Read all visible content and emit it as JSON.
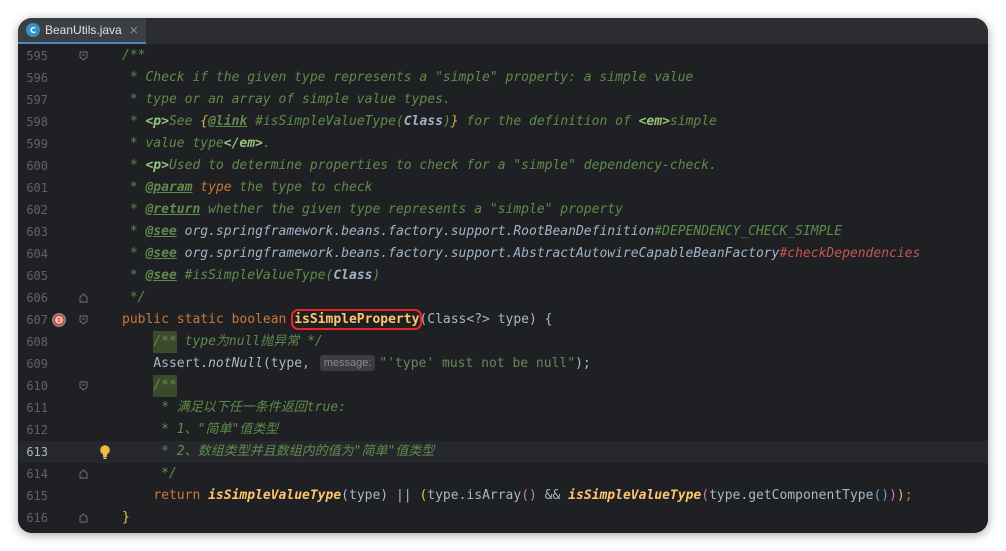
{
  "tab": {
    "icon_letter": "C",
    "file_name": "BeanUtils.java",
    "close_glyph": "×"
  },
  "editor": {
    "current_line": "613"
  },
  "lines": [
    {
      "n": "595",
      "t": [
        "/**"
      ]
    },
    {
      "n": "596",
      "t": [
        " * Check if the given type represents a \"simple\" property: a simple value"
      ]
    },
    {
      "n": "597",
      "t": [
        " * type or an array of simple value types."
      ]
    },
    {
      "n": "598",
      "t": [
        " * ",
        "<p>",
        "See ",
        "{",
        "@link",
        " #isSimpleValueType(",
        "Class",
        ")",
        "}",
        " for the definition of ",
        "<em>",
        "simple"
      ]
    },
    {
      "n": "599",
      "t": [
        " * value type",
        "</em>",
        "."
      ]
    },
    {
      "n": "600",
      "t": [
        " * ",
        "<p>",
        "Used to determine properties to check for a \"simple\" dependency-check."
      ]
    },
    {
      "n": "601",
      "t": [
        " * ",
        "@param",
        " type",
        " the type to check"
      ]
    },
    {
      "n": "602",
      "t": [
        " * ",
        "@return",
        " whether the given type represents a \"simple\" property"
      ]
    },
    {
      "n": "603",
      "t": [
        " * ",
        "@see",
        " ",
        "org.springframework.beans.factory.support.RootBeanDefinition",
        "#DEPENDENCY_CHECK_SIMPLE"
      ]
    },
    {
      "n": "604",
      "t": [
        " * ",
        "@see",
        " ",
        "org.springframework.beans.factory.support.AbstractAutowireCapableBeanFactory",
        "#checkDependencies"
      ]
    },
    {
      "n": "605",
      "t": [
        " * ",
        "@see",
        " #isSimpleValueType(",
        "Class",
        ")"
      ]
    },
    {
      "n": "606",
      "t": [
        " */"
      ]
    },
    {
      "n": "607",
      "t": [
        "public static boolean ",
        "isSimpleProperty",
        "(Class<?> type) {"
      ]
    },
    {
      "n": "608",
      "t": [
        "    ",
        "/**",
        " type为null抛异常 */"
      ]
    },
    {
      "n": "609",
      "t": [
        "    Assert.",
        "notNull",
        "(type, ",
        "message:",
        "\"'type' must not be null\"",
        ");"
      ]
    },
    {
      "n": "610",
      "t": [
        "    ",
        "/**"
      ]
    },
    {
      "n": "611",
      "t": [
        "     * 满足以下任一条件返回true:"
      ]
    },
    {
      "n": "612",
      "t": [
        "     * 1、\"简单\"值类型"
      ]
    },
    {
      "n": "613",
      "t": [
        "     * 2、数组类型并且数组内的值为\"简单\"值类型"
      ]
    },
    {
      "n": "614",
      "t": [
        "     */"
      ]
    },
    {
      "n": "615",
      "t": [
        "    ",
        "return ",
        "isSimpleValueType",
        "(type) || ",
        "(",
        "type.isArray",
        "()",
        " && ",
        "isSimpleValueType",
        "(",
        "type.getComponentType",
        "()",
        ")",
        ")",
        ";"
      ]
    },
    {
      "n": "616",
      "t": [
        "}"
      ]
    }
  ],
  "gutter_icons": {
    "breakpoint": "method-breakpoint-icon",
    "intention": "lightbulb-icon",
    "fold": "fold-marker-icon"
  },
  "colors": {
    "keyword": "#cc7832",
    "method": "#ffc66d",
    "doc_comment": "#5f8c4a",
    "string": "#6a8759",
    "highlight_box": "#e8262a"
  }
}
